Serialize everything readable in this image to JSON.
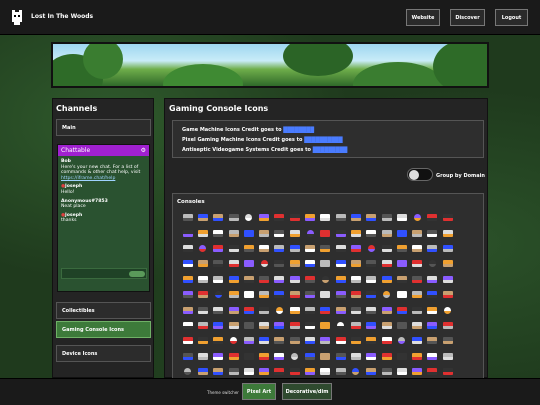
{
  "header": {
    "title": "Lost In The Woods",
    "nav": [
      "Website",
      "Discover",
      "Logout"
    ]
  },
  "channels": {
    "title": "Channels",
    "main_label": "Main",
    "chat": {
      "title": "Chattable",
      "messages": [
        {
          "user": "Bob",
          "text": "Here's your new chat. For a list of commands & other chat help, visit",
          "link": "https://iframe.chat/help"
        },
        {
          "user": "Joseph",
          "text": "Hello!",
          "dot": "#e04040"
        },
        {
          "user": "Anonymous#7853",
          "text": "Neat place"
        },
        {
          "user": "Joseph",
          "text": "thanks",
          "dot": "#e04040"
        }
      ]
    },
    "items": [
      "Collectibles",
      "Gaming Console Icons",
      "Device Icons"
    ]
  },
  "main": {
    "title": "Gaming Console Icons",
    "credits": [
      {
        "text": "Game Machine Icons Credit goes to",
        "link": "████████"
      },
      {
        "text": "Pixel Gaming Machine Icons Credit goes to",
        "link": "██████████"
      },
      {
        "text": "Antiseptic Videogame Systems Credit goes to",
        "link": "█████████"
      }
    ],
    "toggle_label": "Group by Domain",
    "consoles_title": "Consoles"
  },
  "footer": {
    "hint": "Theme switcher",
    "buttons": [
      "Pixel Art",
      "Decorative/dim"
    ]
  },
  "colors": {
    "accent_purple": "#a020d0",
    "active_green": "#3d7a3a",
    "link_blue": "#4a7cff"
  },
  "console_icon_colors": [
    "#bbbbbb",
    "#555555",
    "#e03030",
    "#ffffff",
    "#c8a070",
    "#8a5cff",
    "#f0a030",
    "#3050ff",
    "#dddddd",
    "#333333"
  ]
}
